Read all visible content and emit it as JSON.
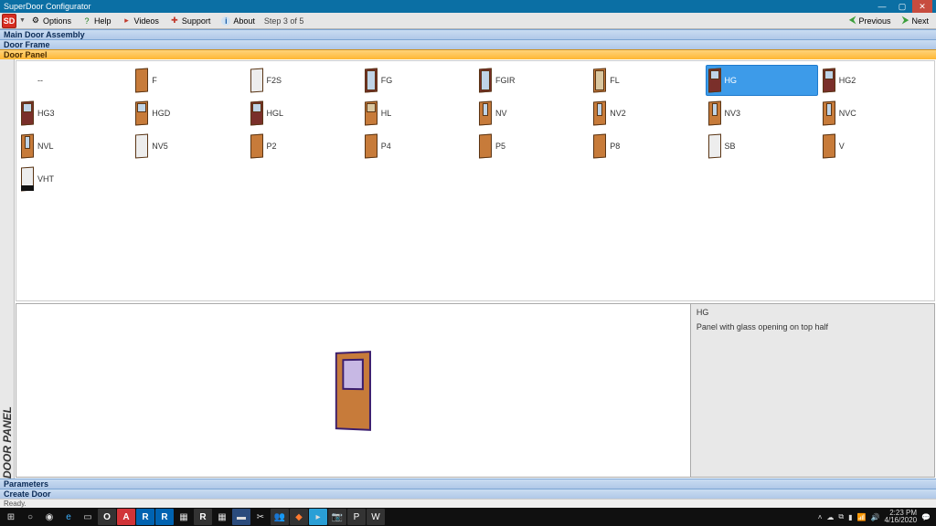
{
  "window": {
    "title": "SuperDoor Configurator"
  },
  "toolbar": {
    "app_icon_text": "SD",
    "options": "Options",
    "help": "Help",
    "videos": "Videos",
    "support": "Support",
    "about": "About",
    "step": "Step 3 of 5",
    "previous": "Previous",
    "next": "Next"
  },
  "sections": {
    "s1": "Main Door Assembly",
    "s2": "Door Frame",
    "s3": "Door Panel"
  },
  "side_label": "DOOR PANEL",
  "panels": {
    "p0": "--",
    "p1": "F",
    "p2": "F2S",
    "p3": "FG",
    "p4": "FGIR",
    "p5": "FL",
    "p6": "HG",
    "p7": "HG2",
    "p8": "HG3",
    "p9": "HGD",
    "p10": "HGL",
    "p11": "HL",
    "p12": "NV",
    "p13": "NV2",
    "p14": "NV3",
    "p15": "NVC",
    "p16": "NVL",
    "p17": "NV5",
    "p18": "P2",
    "p19": "P4",
    "p20": "P5",
    "p21": "P8",
    "p22": "SB",
    "p23": "V",
    "p24": "VHT"
  },
  "selected_panel": "HG",
  "info": {
    "code": "HG",
    "desc": "Panel with glass opening on top half"
  },
  "bottom": {
    "parameters": "Parameters",
    "create": "Create Door"
  },
  "status": "Ready.",
  "tray": {
    "time": "2:23 PM",
    "date": "4/16/2020"
  }
}
